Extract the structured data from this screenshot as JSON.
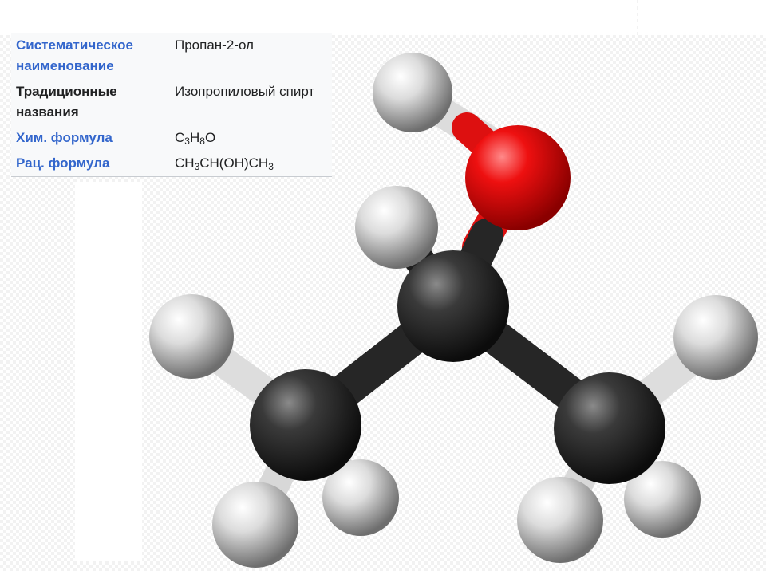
{
  "infobox": {
    "rows": [
      {
        "label": "Систематическое наименование",
        "value": "Пропан-2-ол"
      },
      {
        "label": "Традиционные названия",
        "value": "Изопропиловый спирт"
      },
      {
        "label": "Хим. формула",
        "formula": [
          {
            "t": "C"
          },
          {
            "s": "3"
          },
          {
            "t": "H"
          },
          {
            "s": "8"
          },
          {
            "t": "O"
          }
        ]
      },
      {
        "label": "Рац. формула",
        "formula": [
          {
            "t": "CH"
          },
          {
            "s": "3"
          },
          {
            "t": "CH(OH)CH"
          },
          {
            "s": "3"
          }
        ]
      }
    ]
  },
  "molecule": {
    "colors": {
      "carbon": "#2a2a2a",
      "hydrogen": "#e8e8e8",
      "oxygen": "#e8101a"
    }
  }
}
